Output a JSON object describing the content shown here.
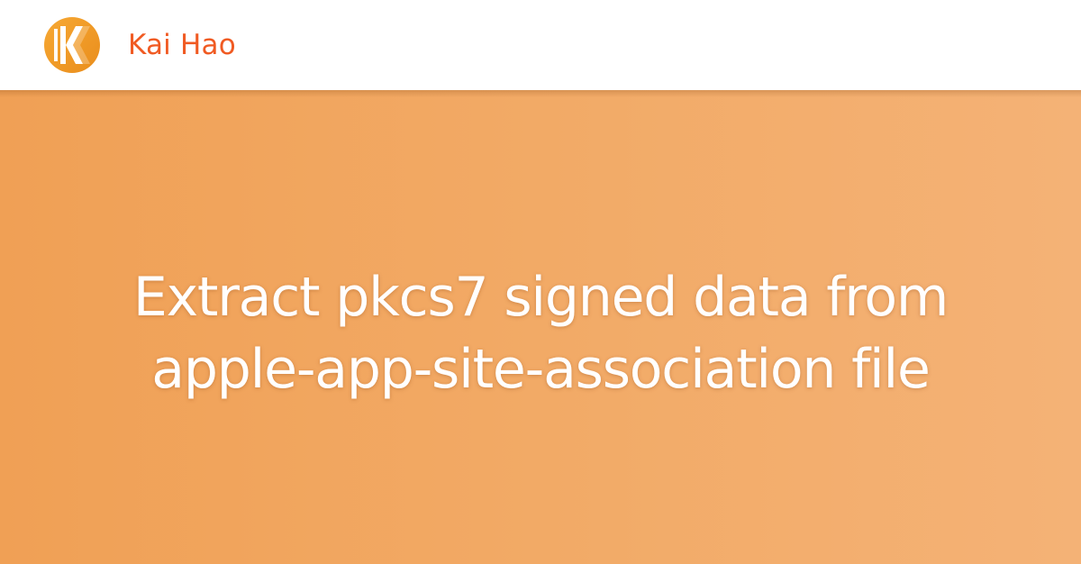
{
  "brand": {
    "name": "Kai Hao",
    "logo_icon": "k-logo-icon",
    "name_color": "#f05a22"
  },
  "hero": {
    "title_lines": [
      "Extract pkcs7 signed data from",
      "apple-app-site-association file"
    ],
    "background_colors": [
      "#f0a055",
      "#f4b276"
    ],
    "title_color": "#ffffff"
  }
}
